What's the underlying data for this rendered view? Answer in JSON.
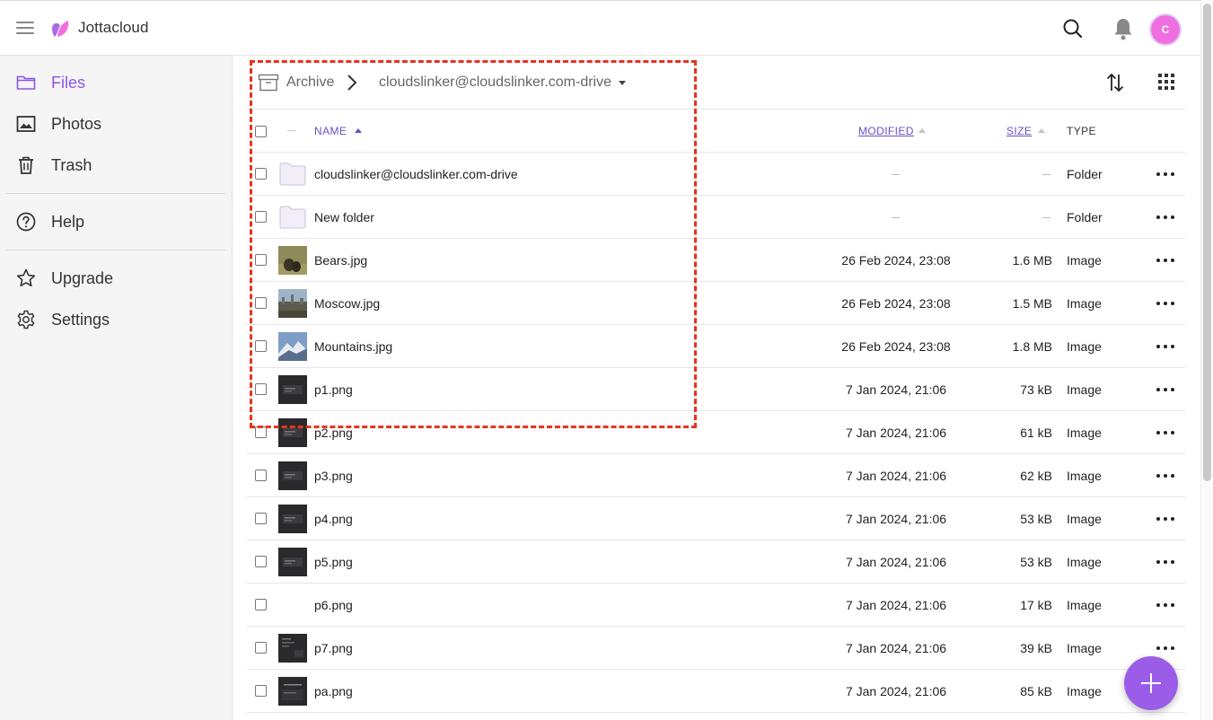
{
  "app": {
    "brand": "Jottacloud",
    "avatar_initial": "C"
  },
  "colors": {
    "accent": "#8b55e6",
    "avatar": "#f06fe0",
    "highlight": "#e8321f",
    "fab": "#9b5de8"
  },
  "sidebar": {
    "items": [
      {
        "label": "Files",
        "icon": "folder-icon",
        "active": true
      },
      {
        "label": "Photos",
        "icon": "image-icon"
      },
      {
        "label": "Trash",
        "icon": "trash-icon"
      },
      {
        "label": "Help",
        "icon": "help-icon"
      },
      {
        "label": "Upgrade",
        "icon": "star-icon"
      },
      {
        "label": "Settings",
        "icon": "gear-icon"
      }
    ]
  },
  "breadcrumb": {
    "root": "Archive",
    "current": "cloudslinker@cloudslinker.com-drive"
  },
  "table": {
    "headers": {
      "name": "NAME",
      "modified": "MODIFIED",
      "size": "SIZE",
      "type": "TYPE"
    },
    "rows": [
      {
        "name": "cloudslinker@cloudslinker.com-drive",
        "modified": "",
        "size": "",
        "type": "Folder",
        "thumb": "folder"
      },
      {
        "name": "New folder",
        "modified": "",
        "size": "",
        "type": "Folder",
        "thumb": "folder"
      },
      {
        "name": "Bears.jpg",
        "modified": "26 Feb 2024, 23:08",
        "size": "1.6 MB",
        "type": "Image",
        "thumb": "bears"
      },
      {
        "name": "Moscow.jpg",
        "modified": "26 Feb 2024, 23:08",
        "size": "1.5 MB",
        "type": "Image",
        "thumb": "moscow"
      },
      {
        "name": "Mountains.jpg",
        "modified": "26 Feb 2024, 23:08",
        "size": "1.8 MB",
        "type": "Image",
        "thumb": "mountains"
      },
      {
        "name": "p1.png",
        "modified": "7 Jan 2024, 21:06",
        "size": "73 kB",
        "type": "Image",
        "thumb": "dark"
      },
      {
        "name": "p2.png",
        "modified": "7 Jan 2024, 21:06",
        "size": "61 kB",
        "type": "Image",
        "thumb": "dark"
      },
      {
        "name": "p3.png",
        "modified": "7 Jan 2024, 21:06",
        "size": "62 kB",
        "type": "Image",
        "thumb": "dark"
      },
      {
        "name": "p4.png",
        "modified": "7 Jan 2024, 21:06",
        "size": "53 kB",
        "type": "Image",
        "thumb": "dark"
      },
      {
        "name": "p5.png",
        "modified": "7 Jan 2024, 21:06",
        "size": "53 kB",
        "type": "Image",
        "thumb": "dark"
      },
      {
        "name": "p6.png",
        "modified": "7 Jan 2024, 21:06",
        "size": "17 kB",
        "type": "Image",
        "thumb": "none"
      },
      {
        "name": "p7.png",
        "modified": "7 Jan 2024, 21:06",
        "size": "39 kB",
        "type": "Image",
        "thumb": "dark"
      },
      {
        "name": "pa.png",
        "modified": "7 Jan 2024, 21:06",
        "size": "85 kB",
        "type": "Image",
        "thumb": "dark"
      }
    ]
  }
}
